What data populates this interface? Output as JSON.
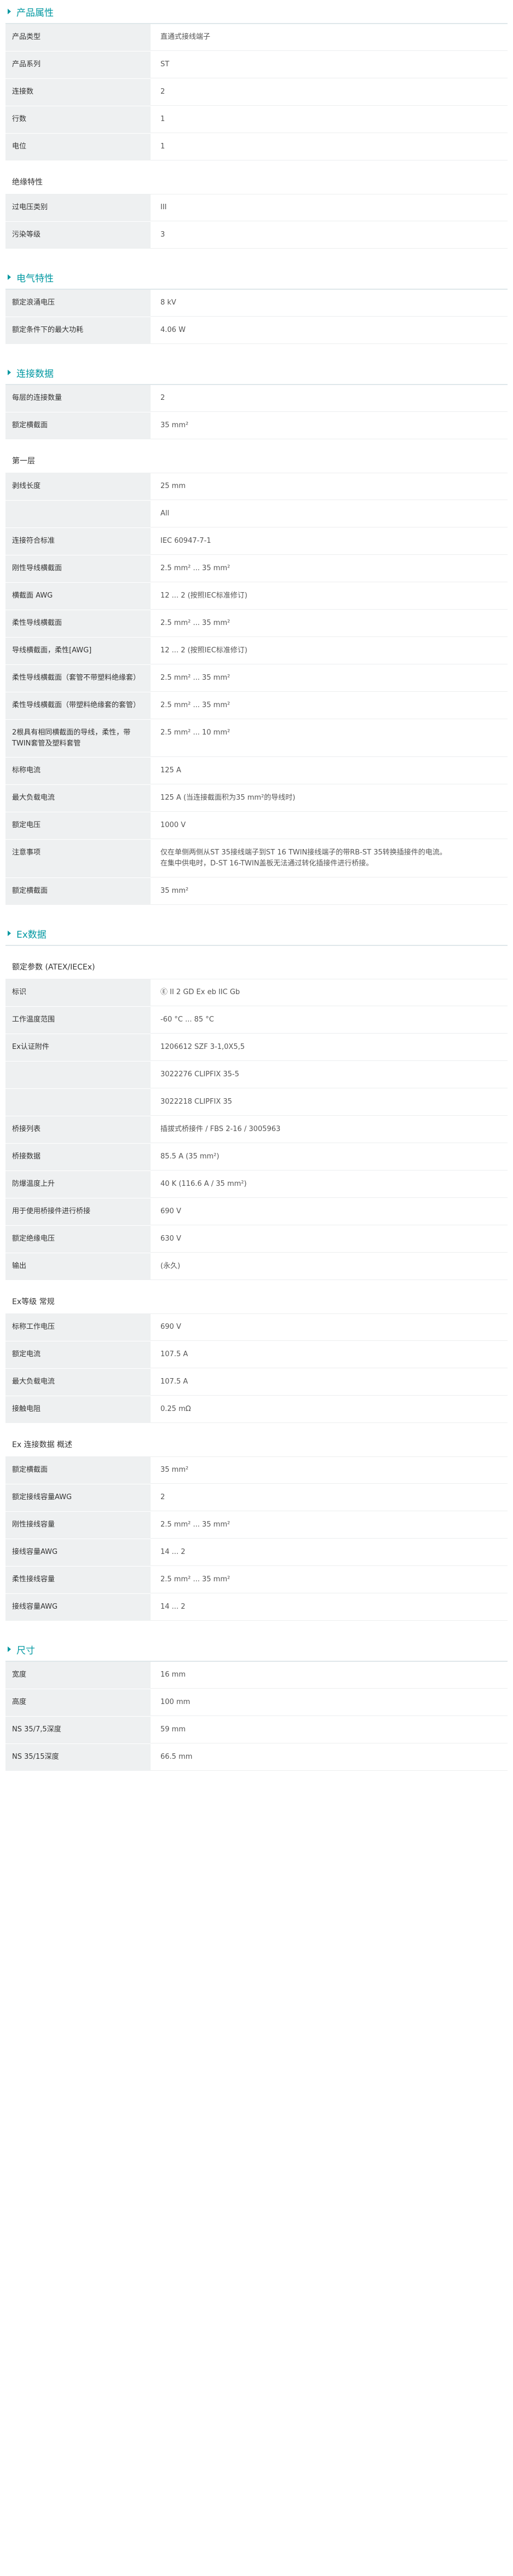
{
  "sections": [
    {
      "title": "产品属性",
      "groups": [
        {
          "subtitle": "",
          "rows": [
            {
              "label": "产品类型",
              "value": [
                "直通式接线端子"
              ]
            },
            {
              "label": "产品系列",
              "value": [
                "ST"
              ]
            },
            {
              "label": "连接数",
              "value": [
                "2"
              ]
            },
            {
              "label": "行数",
              "value": [
                "1"
              ]
            },
            {
              "label": "电位",
              "value": [
                "1"
              ]
            }
          ]
        },
        {
          "subtitle": "绝缘特性",
          "rows": [
            {
              "label": "过电压类别",
              "value": [
                "III"
              ]
            },
            {
              "label": "污染等级",
              "value": [
                "3"
              ]
            }
          ]
        }
      ]
    },
    {
      "title": "电气特性",
      "groups": [
        {
          "subtitle": "",
          "rows": [
            {
              "label": "额定浪涌电压",
              "value": [
                "8 kV"
              ]
            },
            {
              "label": "额定条件下的最大功耗",
              "value": [
                "4.06 W"
              ]
            }
          ]
        }
      ]
    },
    {
      "title": "连接数据",
      "groups": [
        {
          "subtitle": "",
          "rows": [
            {
              "label": "每层的连接数量",
              "value": [
                "2"
              ]
            },
            {
              "label": "额定横截面",
              "value": [
                "35 mm²"
              ]
            }
          ]
        },
        {
          "subtitle": "第一层",
          "rows": [
            {
              "label": "剥线长度",
              "value": [
                "25 mm"
              ]
            },
            {
              "label": "",
              "value": [
                "All"
              ]
            },
            {
              "label": "连接符合标准",
              "value": [
                "IEC 60947-7-1"
              ]
            },
            {
              "label": "刚性导线横截面",
              "value": [
                "2.5 mm² ... 35 mm²"
              ]
            },
            {
              "label": "横截面 AWG",
              "value": [
                "12 ... 2 (按照IEC标准修订)"
              ]
            },
            {
              "label": "柔性导线横截面",
              "value": [
                "2.5 mm² ... 35 mm²"
              ]
            },
            {
              "label": "导线横截面，柔性[AWG]",
              "value": [
                "12 ... 2 (按照IEC标准修订)"
              ]
            },
            {
              "label": "柔性导线横截面（套管不带塑料绝缘套）",
              "value": [
                "2.5 mm² ... 35 mm²"
              ]
            },
            {
              "label": "柔性导线横截面（带塑料绝缘套的套管）",
              "value": [
                "2.5 mm² ... 35 mm²"
              ]
            },
            {
              "label": "2根具有相同横截面的导线，柔性，带TWIN套管及塑料套管",
              "value": [
                "2.5 mm² ... 10 mm²"
              ]
            },
            {
              "label": "标称电流",
              "value": [
                "125 A"
              ]
            },
            {
              "label": "最大负载电流",
              "value": [
                "125 A (当连接截面积为35 mm²的导线时)"
              ]
            },
            {
              "label": "额定电压",
              "value": [
                "1000 V"
              ]
            },
            {
              "label": "注意事项",
              "value": [
                "仅在单侧两侧从ST 35接线端子到ST 16 TWIN接线端子的带RB-ST 35转换插接件的电流。",
                "在集中供电时，D-ST 16-TWIN盖板无法通过转化插接件进行桥接。"
              ]
            },
            {
              "label": "额定横截面",
              "value": [
                "35 mm²"
              ]
            }
          ]
        }
      ]
    },
    {
      "title": "Ex数据",
      "groups": [
        {
          "subtitle": "额定参数 (ATEX/IECEx)",
          "rows": [
            {
              "label": "标识",
              "value": [
                "Ⓔ II 2 GD  Ex eb IIC Gb"
              ]
            },
            {
              "label": "工作温度范围",
              "value": [
                "-60 °C ... 85 °C"
              ]
            },
            {
              "label": "Ex认证附件",
              "value": [
                "1206612 SZF 3-1,0X5,5"
              ]
            },
            {
              "label": "",
              "value": [
                "3022276 CLIPFIX 35-5"
              ]
            },
            {
              "label": "",
              "value": [
                "3022218 CLIPFIX 35"
              ]
            },
            {
              "label": "桥接列表",
              "value": [
                "插拔式桥接件 / FBS 2-16 / 3005963"
              ]
            },
            {
              "label": "桥接数据",
              "value": [
                "85.5 A (35 mm²)"
              ]
            },
            {
              "label": "防爆温度上升",
              "value": [
                "40 K (116.6 A / 35 mm²)"
              ]
            },
            {
              "label": "用于使用桥接件进行桥接",
              "value": [
                "690 V"
              ]
            },
            {
              "label": "额定绝缘电压",
              "value": [
                "630 V"
              ]
            },
            {
              "label": "输出",
              "value": [
                "(永久)"
              ]
            }
          ]
        },
        {
          "subtitle": "Ex等级 常规",
          "rows": [
            {
              "label": "标称工作电压",
              "value": [
                "690 V"
              ]
            },
            {
              "label": "额定电流",
              "value": [
                "107.5 A"
              ]
            },
            {
              "label": "最大负载电流",
              "value": [
                "107.5 A"
              ]
            },
            {
              "label": "接触电阻",
              "value": [
                "0.25 mΩ"
              ]
            }
          ]
        },
        {
          "subtitle": "Ex 连接数据 概述",
          "rows": [
            {
              "label": "额定横截面",
              "value": [
                "35 mm²"
              ]
            },
            {
              "label": "额定接线容量AWG",
              "value": [
                "2"
              ]
            },
            {
              "label": "刚性接线容量",
              "value": [
                "2.5 mm² ... 35 mm²"
              ]
            },
            {
              "label": "接线容量AWG",
              "value": [
                "14 ... 2"
              ]
            },
            {
              "label": "柔性接线容量",
              "value": [
                "2.5 mm² ... 35 mm²"
              ]
            },
            {
              "label": "接线容量AWG",
              "value": [
                "14 ... 2"
              ]
            }
          ]
        }
      ]
    },
    {
      "title": "尺寸",
      "groups": [
        {
          "subtitle": "",
          "rows": [
            {
              "label": "宽度",
              "value": [
                "16 mm"
              ]
            },
            {
              "label": "高度",
              "value": [
                "100 mm"
              ]
            },
            {
              "label": "NS 35/7,5深度",
              "value": [
                "59 mm"
              ]
            },
            {
              "label": "NS 35/15深度",
              "value": [
                "66.5 mm"
              ]
            }
          ]
        }
      ]
    }
  ]
}
